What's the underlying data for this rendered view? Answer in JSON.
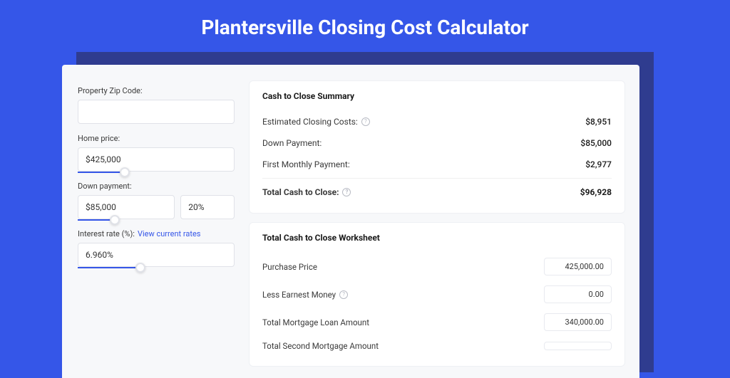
{
  "title": "Plantersville Closing Cost Calculator",
  "form": {
    "zip_label": "Property Zip Code:",
    "zip_value": "",
    "home_price_label": "Home price:",
    "home_price_value": "$425,000",
    "home_price_slider_pct": 30,
    "down_payment_label": "Down payment:",
    "down_payment_value": "$85,000",
    "down_payment_pct_value": "20%",
    "down_payment_slider_pct": 38,
    "interest_label": "Interest rate (%):",
    "interest_link": "View current rates",
    "interest_value": "6.960%",
    "interest_slider_pct": 40
  },
  "summary": {
    "title": "Cash to Close Summary",
    "rows": [
      {
        "label": "Estimated Closing Costs:",
        "value": "$8,951",
        "help": true
      },
      {
        "label": "Down Payment:",
        "value": "$85,000",
        "help": false
      },
      {
        "label": "First Monthly Payment:",
        "value": "$2,977",
        "help": false
      }
    ],
    "total_label": "Total Cash to Close:",
    "total_value": "$96,928"
  },
  "worksheet": {
    "title": "Total Cash to Close Worksheet",
    "rows": [
      {
        "label": "Purchase Price",
        "value": "425,000.00",
        "help": false
      },
      {
        "label": "Less Earnest Money",
        "value": "0.00",
        "help": true
      },
      {
        "label": "Total Mortgage Loan Amount",
        "value": "340,000.00",
        "help": false
      },
      {
        "label": "Total Second Mortgage Amount",
        "value": "",
        "help": false
      }
    ]
  }
}
